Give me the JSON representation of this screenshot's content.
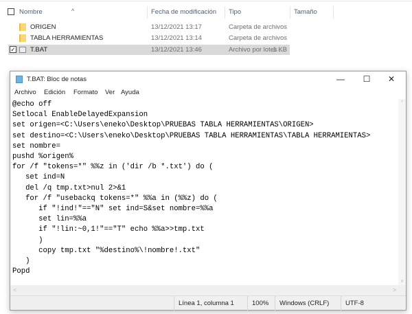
{
  "explorer": {
    "columns": {
      "name": "Nombre",
      "date": "Fecha de modificación",
      "type": "Tipo",
      "size": "Tamaño"
    },
    "files": [
      {
        "name": "ORIGEN",
        "date": "13/12/2021 13:17",
        "type": "Carpeta de archivos",
        "size": "",
        "icon": "folder-icon"
      },
      {
        "name": "TABLA HERRAMIENTAS",
        "date": "13/12/2021 13:14",
        "type": "Carpeta de archivos",
        "size": "",
        "icon": "folder-icon"
      },
      {
        "name": "T.BAT",
        "date": "13/12/2021 13:46",
        "type": "Archivo por lotes ...",
        "size": "1 KB",
        "icon": "batch-file-icon",
        "selected": true
      }
    ]
  },
  "notepad": {
    "title": "T.BAT: Bloc de notas",
    "menu": [
      "Archivo",
      "Edición",
      "Formato",
      "Ver",
      "Ayuda"
    ],
    "content": "@echo off\nSetlocal EnableDelayedExpansion\nset origen=<C:\\Users\\eneko\\Desktop\\PRUEBAS TABLA HERRAMIENTAS\\ORIGEN>\nset destino=<C:\\Users\\eneko\\Desktop\\PRUEBAS TABLA HERRAMIENTAS\\TABLA HERRAMIENTAS>\nset nombre=\npushd %origen%\nfor /f \"tokens=*\" %%z in ('dir /b *.txt') do (\n   set ind=N\n   del /q tmp.txt>nul 2>&1\n   for /f \"usebackq tokens=*\" %%a in (%%z) do (\n      if \"!ind!\"==\"N\" set ind=S&set nombre=%%a\n      set lin=%%a\n      if \"!lin:~0,1!\"==\"T\" echo %%a>>tmp.txt\n      )\n      copy tmp.txt \"%destino%\\!nombre!.txt\"\n   )\nPopd",
    "status": {
      "position": "Línea 1, columna 1",
      "zoom": "100%",
      "line_ending": "Windows (CRLF)",
      "encoding": "UTF-8"
    }
  }
}
